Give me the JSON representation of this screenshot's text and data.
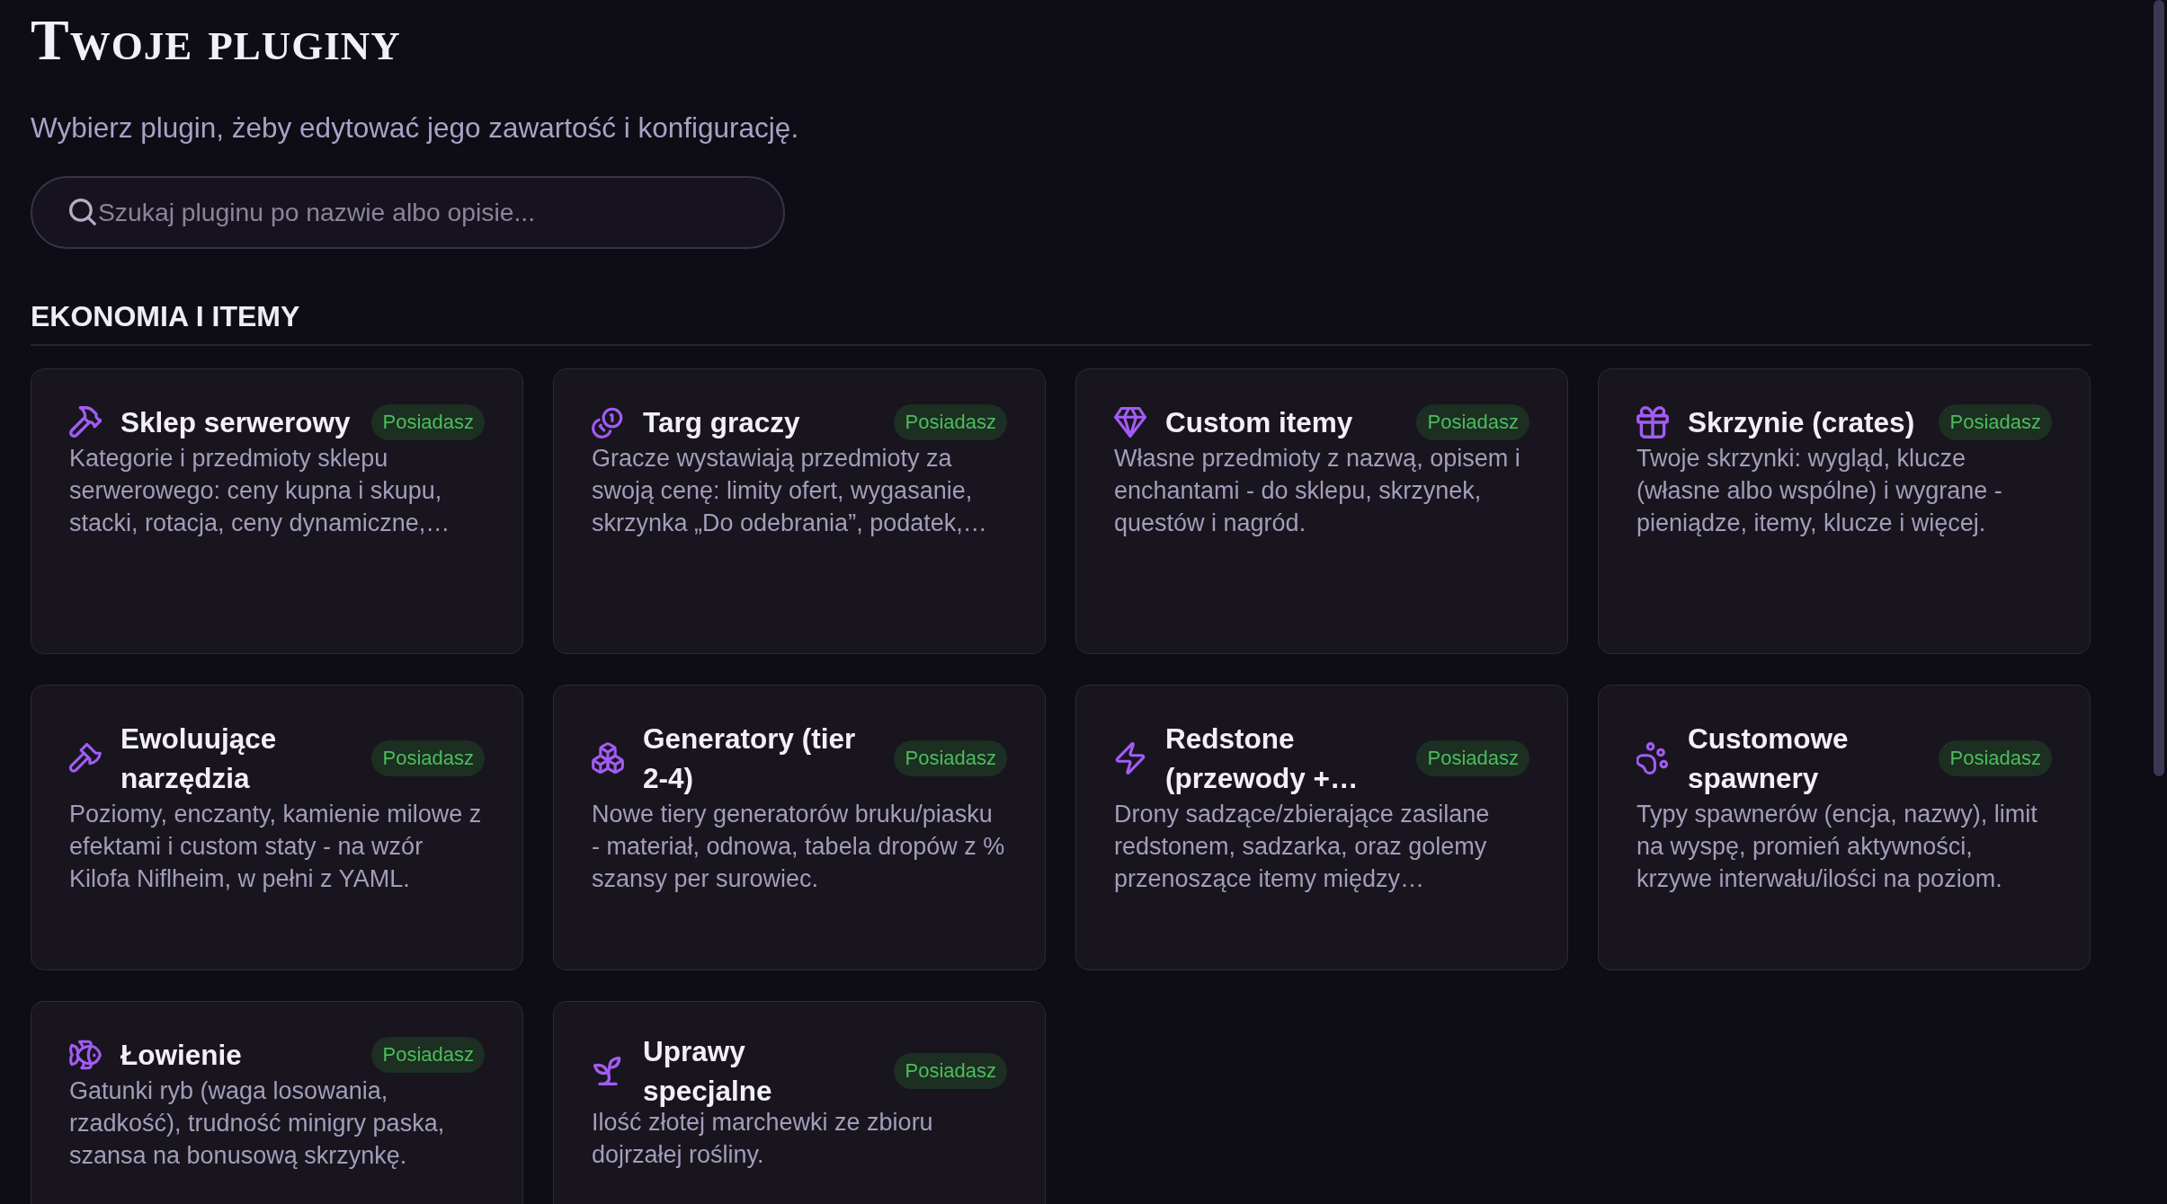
{
  "page": {
    "title": "Twoje pluginy",
    "subtitle": "Wybierz plugin, żeby edytować jego zawartość i konfigurację."
  },
  "search": {
    "placeholder": "Szukaj pluginu po nazwie albo opisie..."
  },
  "sections": [
    {
      "heading": "EKONOMIA I ITEMY",
      "plugins": [
        {
          "name": "Sklep serwerowy",
          "badge": "Posiadasz",
          "description": "Kategorie i przedmioty sklepu serwerowego: ceny kupna i skupu, stacki, rotacja, ceny dynamiczne,…"
        },
        {
          "name": "Targ graczy",
          "badge": "Posiadasz",
          "description": "Gracze wystawiają przedmioty za swoją cenę: limity ofert, wygasanie, skrzynka „Do odebrania”, podatek,…"
        },
        {
          "name": "Custom itemy",
          "badge": "Posiadasz",
          "description": "Własne przedmioty z nazwą, opisem i enchantami - do sklepu, skrzynek, questów i nagród."
        },
        {
          "name": "Skrzynie (crates)",
          "badge": "Posiadasz",
          "description": "Twoje skrzynki: wygląd, klucze (własne albo wspólne) i wygrane - pieniądze, itemy, klucze i więcej."
        },
        {
          "name": "Ewoluujące narzędzia",
          "badge": "Posiadasz",
          "description": "Poziomy, enczanty, kamienie milowe z efektami i custom staty - na wzór Kilofa Niflheim, w pełni z YAML."
        },
        {
          "name": "Generatory (tier 2-4)",
          "badge": "Posiadasz",
          "description": "Nowe tiery generatorów bruku/piasku - materiał, odnowa, tabela dropów z % szansy per surowiec."
        },
        {
          "name": "Redstone (przewody +…",
          "badge": "Posiadasz",
          "description": "Drony sadzące/zbierające zasilane redstonem, sadzarka, oraz golemy przenoszące itemy między…"
        },
        {
          "name": "Customowe spawnery",
          "badge": "Posiadasz",
          "description": "Typy spawnerów (encja, nazwy), limit na wyspę, promień aktywności, krzywe interwału/ilości na poziom."
        },
        {
          "name": "Łowienie",
          "badge": "Posiadasz",
          "description": "Gatunki ryb (waga losowania, rzadkość), trudność minigry paska, szansa na bonusową skrzynkę."
        },
        {
          "name": "Uprawy specjalne",
          "badge": "Posiadasz",
          "description": "Ilość złotej marchewki ze zbioru dojrzałej rośliny."
        }
      ]
    }
  ]
}
